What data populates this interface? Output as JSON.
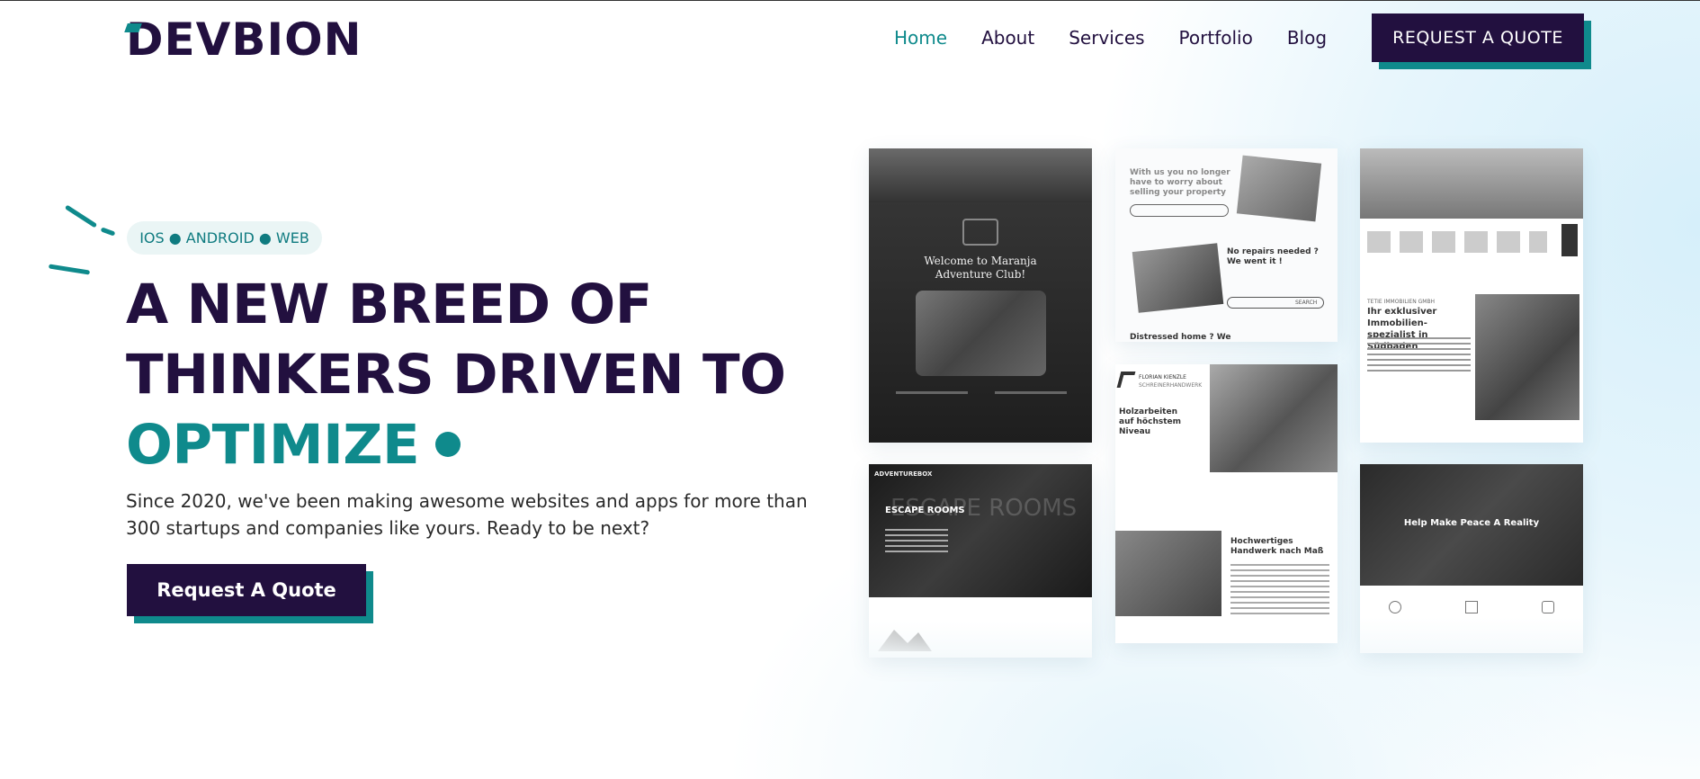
{
  "brand": {
    "logo_text": "DEVBION",
    "accent_color": "#0f8a8c",
    "primary_color": "#22103f"
  },
  "nav": {
    "items": [
      {
        "label": "Home",
        "active": true
      },
      {
        "label": "About",
        "active": false
      },
      {
        "label": "Services",
        "active": false
      },
      {
        "label": "Portfolio",
        "active": false
      },
      {
        "label": "Blog",
        "active": false
      }
    ],
    "cta_label": "REQUEST A QUOTE"
  },
  "hero": {
    "tag": "IOS ● ANDROID ● WEB",
    "headline_line1": "A NEW BREED OF",
    "headline_line2": "THINKERS DRIVEN TO",
    "headline_accent": "OPTIMIZE",
    "subtext": "Since 2020, we've been making awesome websites and apps for more than 300 startups and companies like yours. Ready to be next?",
    "cta_label": "Request A Quote"
  },
  "portfolio": {
    "shot1": {
      "title": "Welcome to Maranja Adventure Club!"
    },
    "shot2": {
      "heading1": "With us you no longer have to worry about selling your property",
      "heading2": "No repairs needed ? We went it !",
      "heading3": "Distressed home ? We want",
      "button": "SEARCH"
    },
    "shot3": {
      "company": "TETIE IMMOBILIEN GMBH",
      "heading": "Ihr exklusiver Immobilien-spezialist in Südbaden"
    },
    "shot4": {
      "brand": "ADVENTUREBOX",
      "heading": "ESCAPE ROOMS",
      "overlay": "ESCAPE ROOMS"
    },
    "shot5": {
      "brand_line1": "FLORIAN KIENZLE",
      "brand_line2": "SCHREINERHANDWERK",
      "heading1": "Holzarbeiten auf höchstem Niveau",
      "heading2": "Hochwertiges Handwerk nach Maß"
    },
    "shot6": {
      "heading": "Help Make Peace A Reality"
    }
  }
}
